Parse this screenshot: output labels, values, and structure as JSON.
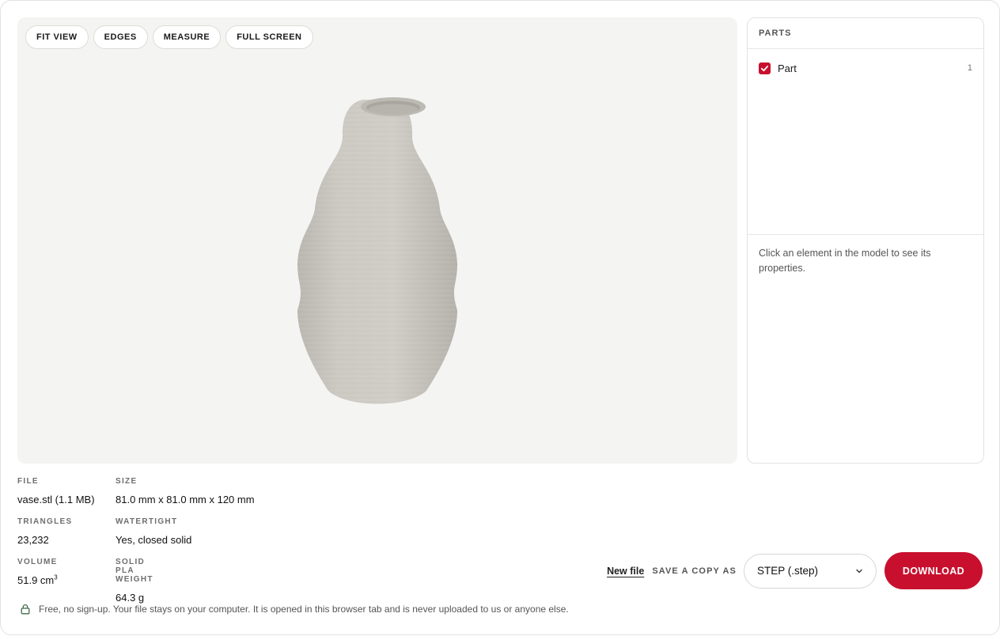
{
  "toolbar": {
    "fit_view": "FIT VIEW",
    "edges": "EDGES",
    "measure": "MEASURE",
    "full_screen": "FULL SCREEN"
  },
  "parts_panel": {
    "header": "PARTS",
    "items": [
      {
        "label": "Part",
        "count": "1",
        "checked": true
      }
    ],
    "hint": "Click an element in the model to see its properties."
  },
  "info": {
    "file_label": "FILE",
    "file_value": "vase.stl (1.1 MB)",
    "size_label": "SIZE",
    "size_value": "81.0 mm x 81.0 mm x 120 mm",
    "triangles_label": "TRIANGLES",
    "triangles_value": "23,232",
    "watertight_label": "WATERTIGHT",
    "watertight_value": "Yes, closed solid",
    "volume_label": "VOLUME",
    "volume_value": "51.9 cm",
    "volume_unit_exp": "3",
    "weight_label": "SOLID PLA WEIGHT",
    "weight_value": "64.3 g"
  },
  "actions": {
    "new_file": "New file",
    "save_copy_label": "SAVE A COPY AS",
    "format_selected": "STEP (.step)",
    "download": "DOWNLOAD"
  },
  "footer": {
    "note": "Free, no sign-up. Your file stays on your computer. It is opened in this browser tab and is never uploaded to us or anyone else."
  },
  "colors": {
    "accent": "#c8102e",
    "viewer_bg": "#f4f4f2",
    "model": "#c9c6c0"
  },
  "icons": {
    "checkbox": "check-icon",
    "select": "chevron-down-icon",
    "footer": "lock-icon"
  }
}
